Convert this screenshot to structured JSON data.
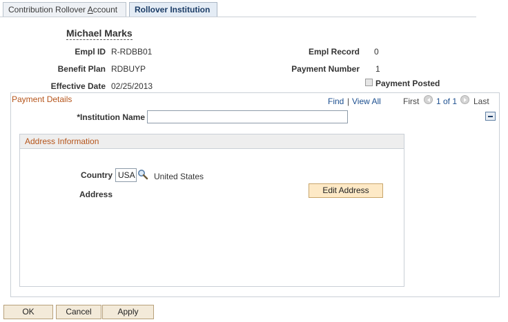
{
  "tabs": [
    {
      "label_pre": "Contribution Rollover ",
      "label_ul": "A",
      "label_post": "ccount"
    },
    {
      "label": "Rollover Institution"
    }
  ],
  "employee": {
    "name": "Michael Marks",
    "empl_id_label": "Empl ID",
    "empl_id": "R-RDBB01",
    "benefit_plan_label": "Benefit Plan",
    "benefit_plan": "RDBUYP",
    "effective_date_label": "Effective Date",
    "effective_date": "02/25/2013",
    "empl_record_label": "Empl Record",
    "empl_record": "0",
    "payment_number_label": "Payment Number",
    "payment_number": "1",
    "payment_posted_label": "Payment Posted"
  },
  "payment_details": {
    "title": "Payment Details",
    "find": "Find",
    "separator": "|",
    "view_all": "View All",
    "first": "First",
    "pager": "1 of 1",
    "last": "Last",
    "institution_label": "*Institution Name",
    "institution_value": ""
  },
  "address_info": {
    "title": "Address Information",
    "country_label": "Country",
    "country_code": "USA",
    "country_name": "United States",
    "address_label": "Address",
    "edit_address_button": "Edit Address"
  },
  "buttons": {
    "ok": "OK",
    "cancel_pre": "Cancel",
    "apply_pre": "Apply"
  }
}
